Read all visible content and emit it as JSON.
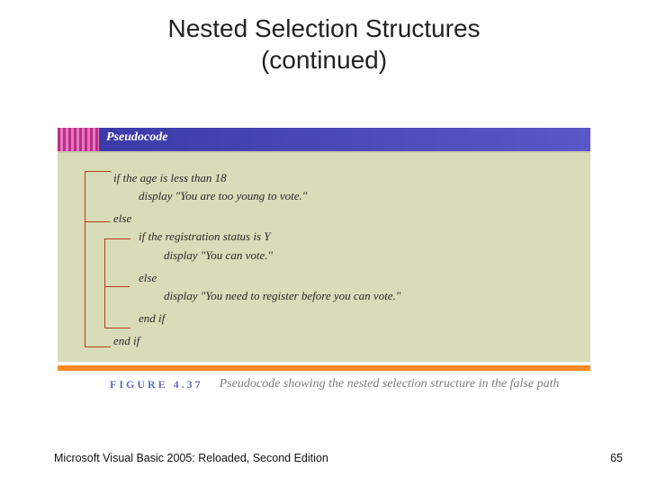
{
  "title_line1": "Nested Selection Structures",
  "title_line2": "(continued)",
  "tab_label": "Pseudocode",
  "pseudocode": {
    "l0": "if the age is less than 18",
    "l1": "display \"You are too young to vote.\"",
    "l2": "else",
    "l3": "if the registration status is Y",
    "l4": "display \"You can vote.\"",
    "l5": "else",
    "l6": "display \"You need to register before you can vote.\"",
    "l7": "end if",
    "l8": "end if"
  },
  "figure_tag": "FIGURE 4.37",
  "figure_caption": "Pseudocode showing the nested selection structure in the false path",
  "footer_left": "Microsoft Visual Basic 2005: Reloaded, Second Edition",
  "page_number": "65"
}
